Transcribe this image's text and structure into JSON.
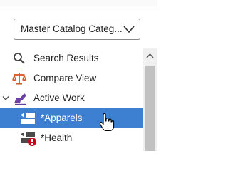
{
  "catalog_selector": {
    "value": "Master Catalog Categ..."
  },
  "tree": {
    "items": [
      {
        "label": "Search Results",
        "icon": "search-icon"
      },
      {
        "label": "Compare View",
        "icon": "scale-icon"
      },
      {
        "label": "Active Work",
        "icon": "edit-folder-icon",
        "expanded": true
      },
      {
        "label": "*Apparels",
        "icon": "workspace-icon",
        "selected": true
      },
      {
        "label": "*Health",
        "icon": "workspace-error-icon"
      }
    ]
  },
  "colors": {
    "selection": "#3d7fd1",
    "compare_icon": "#d9541e",
    "active_work_icon": "#6a3fa0",
    "error_badge": "#d0021b"
  }
}
